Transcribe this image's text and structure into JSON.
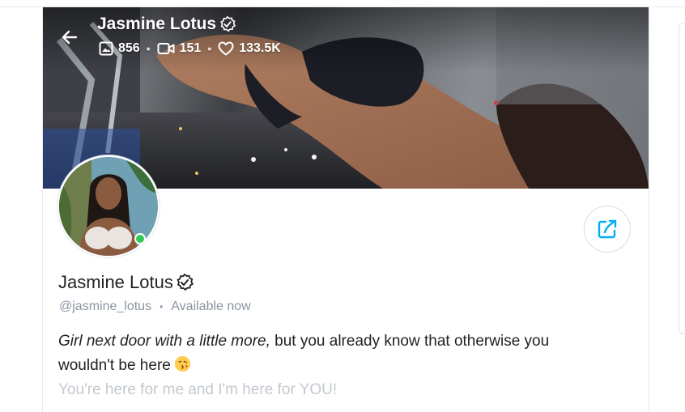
{
  "cover": {
    "name": "Jasmine Lotus",
    "stats": [
      {
        "icon": "image-icon",
        "value": "856"
      },
      {
        "icon": "video-icon",
        "value": "151"
      },
      {
        "icon": "heart-icon",
        "value": "133.5K"
      }
    ]
  },
  "profile": {
    "name": "Jasmine Lotus",
    "handle": "@jasmine_lotus",
    "separator": "•",
    "status": "Available now",
    "bio_italic": "Girl next door with a little more,",
    "bio_rest": " but you already know that otherwise you wouldn't be here",
    "bio_faded": "You're here for me and I'm here for YOU!"
  },
  "icons": {
    "back": "arrow-left-icon",
    "verified": "verified-badge-icon",
    "share": "share-icon",
    "emoji": "kissing-face-emoji"
  },
  "colors": {
    "accent": "#00aff0",
    "online": "#38c755",
    "muted_text": "#8a96a3",
    "faded_text": "#c4c9ce",
    "primary_text": "#222222"
  }
}
